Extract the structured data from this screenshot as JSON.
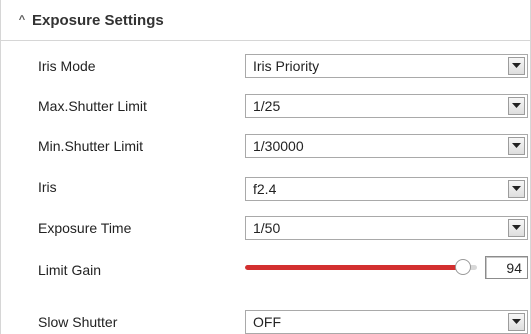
{
  "section": {
    "title": "Exposure Settings",
    "collapse_icon": "chevron-up-icon"
  },
  "fields": {
    "iris_mode": {
      "label": "Iris Mode",
      "value": "Iris Priority"
    },
    "max_shutter": {
      "label": "Max.Shutter Limit",
      "value": "1/25"
    },
    "min_shutter": {
      "label": "Min.Shutter Limit",
      "value": "1/30000"
    },
    "iris": {
      "label": "Iris",
      "value": "f2.4"
    },
    "exposure_time": {
      "label": "Exposure Time",
      "value": "1/50"
    },
    "limit_gain": {
      "label": "Limit Gain",
      "value": "94",
      "max": 100,
      "fill_fraction": 0.94
    },
    "slow_shutter": {
      "label": "Slow Shutter",
      "value": "OFF"
    }
  },
  "colors": {
    "slider_fill": "#d32f2f",
    "slider_track": "#d8d8d8"
  }
}
